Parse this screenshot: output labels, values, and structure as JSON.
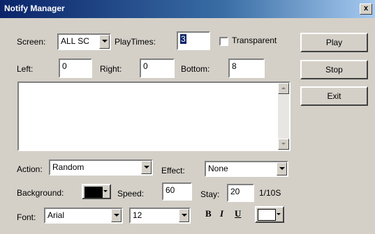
{
  "window": {
    "title": "Notify Manager",
    "close_label": "x"
  },
  "screen": {
    "label": "Screen:",
    "value": "ALL SC"
  },
  "play_times": {
    "label": "PlayTimes:",
    "value": "3"
  },
  "transparent": {
    "label": "Transparent",
    "checked": false
  },
  "left": {
    "label": "Left:",
    "value": "0"
  },
  "right": {
    "label": "Right:",
    "value": "0"
  },
  "bottom": {
    "label": "Bottom:",
    "value": "8"
  },
  "message": {
    "value": ""
  },
  "action": {
    "label": "Action:",
    "value": "Random"
  },
  "effect": {
    "label": "Effect:",
    "value": "None"
  },
  "background": {
    "label": "Background:",
    "color": "#000000"
  },
  "speed": {
    "label": "Speed:",
    "value": "60"
  },
  "stay": {
    "label": "Stay:",
    "value": "20",
    "unit": "1/10S"
  },
  "font": {
    "label": "Font:",
    "value": "Arial",
    "size": "12",
    "color": "#ffffff"
  },
  "format": {
    "bold": "B",
    "italic": "I",
    "underline": "U"
  },
  "buttons": {
    "play": "Play",
    "stop": "Stop",
    "exit": "Exit"
  }
}
